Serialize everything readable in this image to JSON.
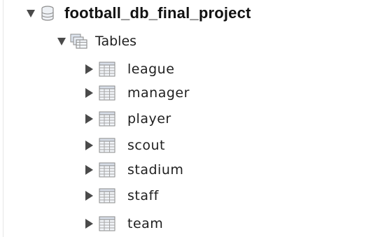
{
  "tree": {
    "database": {
      "name": "football_db_final_project",
      "expanded": true,
      "icon": "database-icon"
    },
    "group": {
      "label": "Tables",
      "expanded": true,
      "icon": "tables-folder-icon"
    },
    "tables": [
      {
        "name": "league",
        "icon": "table-grid-icon",
        "expanded": false
      },
      {
        "name": "manager",
        "icon": "table-grid-icon",
        "expanded": false
      },
      {
        "name": "player",
        "icon": "table-grid-icon",
        "expanded": false
      },
      {
        "name": "scout",
        "icon": "table-grid-icon",
        "expanded": false
      },
      {
        "name": "stadium",
        "icon": "table-grid-icon",
        "expanded": false
      },
      {
        "name": "staff",
        "icon": "table-grid-icon",
        "expanded": false
      },
      {
        "name": "team",
        "icon": "table-grid-icon",
        "expanded": false
      }
    ]
  },
  "colors": {
    "background": "#ffffff",
    "text": "#1f1f1f",
    "arrow": "#4a4a4a",
    "icon_stroke": "#8c8c8c",
    "icon_fill": "#e9eef5"
  }
}
